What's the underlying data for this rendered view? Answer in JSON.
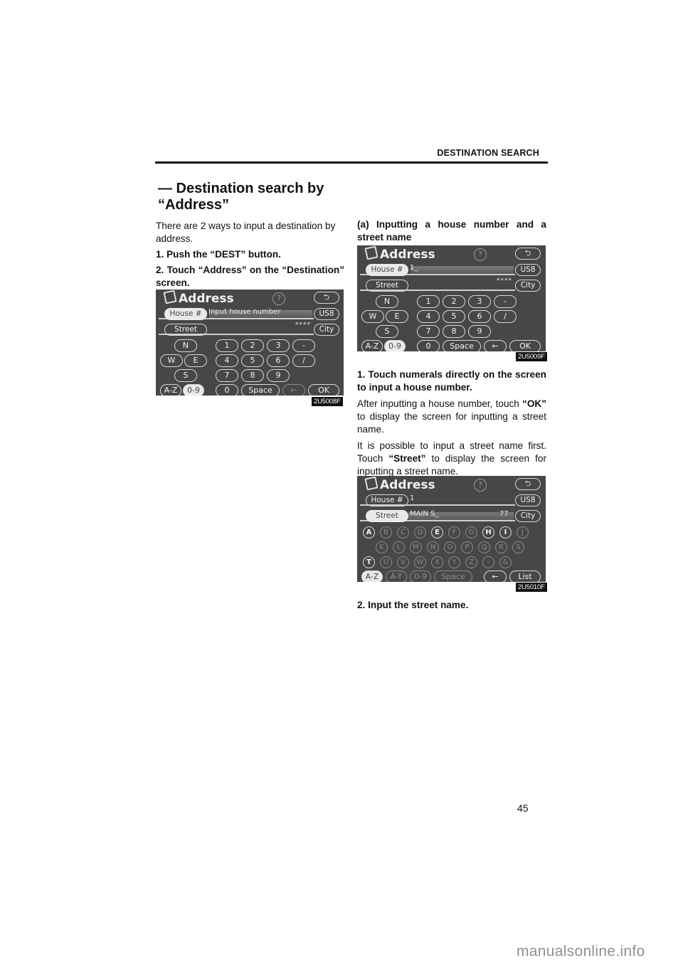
{
  "header": {
    "running_head": "DESTINATION SEARCH"
  },
  "section": {
    "title_line1": "— Destination search by",
    "title_line2": "“Address”"
  },
  "left": {
    "intro": "There are 2 ways to input a destination by address.",
    "step1": "1.  Push the “DEST” button.",
    "step2": "2.  Touch “Address” on the “Destination” screen."
  },
  "right": {
    "subhead": "(a)  Inputting a house number and a street name",
    "step1": "1. Touch numerals directly on the screen to input a house number.",
    "para1_pre": "After inputting a house number, touch ",
    "para1_bold": "“OK”",
    "para1_post": " to display the screen for inputting a street name.",
    "para2_pre": "It is possible to input a street name first. Touch ",
    "para2_bold": "“Street”",
    "para2_post": " to display the screen for inputting a street name.",
    "step2": "2.  Input the street name."
  },
  "figures": [
    {
      "id_label": "2U5008F",
      "title": "Address",
      "help": "?",
      "back": "⮌",
      "house_label": "House #",
      "house_value": "Input house number",
      "street_label": "Street",
      "street_value": "",
      "stars": "****",
      "state_btn": "US8",
      "city_btn": "City",
      "dir_keys": [
        "N",
        "W",
        "E",
        "S"
      ],
      "num_keys": [
        "1",
        "2",
        "3",
        "-",
        "4",
        "5",
        "6",
        "/",
        "7",
        "8",
        "9",
        "0"
      ],
      "az": "A-Z",
      "num_mode": "0-9",
      "space": "Space",
      "backspace": "←",
      "ok": "OK"
    },
    {
      "id_label": "2U5009F",
      "title": "Address",
      "help": "?",
      "back": "⮌",
      "house_label": "House #",
      "house_value": "1_",
      "street_label": "Street",
      "street_value": "",
      "stars": "****",
      "state_btn": "US8",
      "city_btn": "City",
      "dir_keys": [
        "N",
        "W",
        "E",
        "S"
      ],
      "num_keys": [
        "1",
        "2",
        "3",
        "-",
        "4",
        "5",
        "6",
        "/",
        "7",
        "8",
        "9",
        "0"
      ],
      "az": "A-Z",
      "num_mode": "0-9",
      "space": "Space",
      "backspace": "←",
      "ok": "OK"
    },
    {
      "id_label": "2U5010F",
      "title": "Address",
      "help": "?",
      "back": "⮌",
      "house_label": "House #",
      "house_value": "1",
      "street_label": "Street",
      "street_value": "MAIN S_",
      "count": "77",
      "state_btn": "US8",
      "city_btn": "City",
      "letters_row1": [
        "A",
        "B",
        "C",
        "D",
        "E",
        "F",
        "G",
        "H",
        "I",
        "J"
      ],
      "letters_row2": [
        "K",
        "L",
        "M",
        "N",
        "O",
        "P",
        "Q",
        "R",
        "S"
      ],
      "letters_row3": [
        "T",
        "U",
        "V",
        "W",
        "X",
        "Y",
        "Z",
        "-",
        "&"
      ],
      "enabled_letters": [
        "A",
        "E",
        "H",
        "I",
        "T"
      ],
      "az": "A-Z",
      "ay": "À-Ÿ",
      "num_mode": "0-9",
      "space": "Space",
      "backspace": "←",
      "list": "List"
    }
  ],
  "footer": {
    "page_number": "45",
    "watermark": "manualsonline.info"
  }
}
